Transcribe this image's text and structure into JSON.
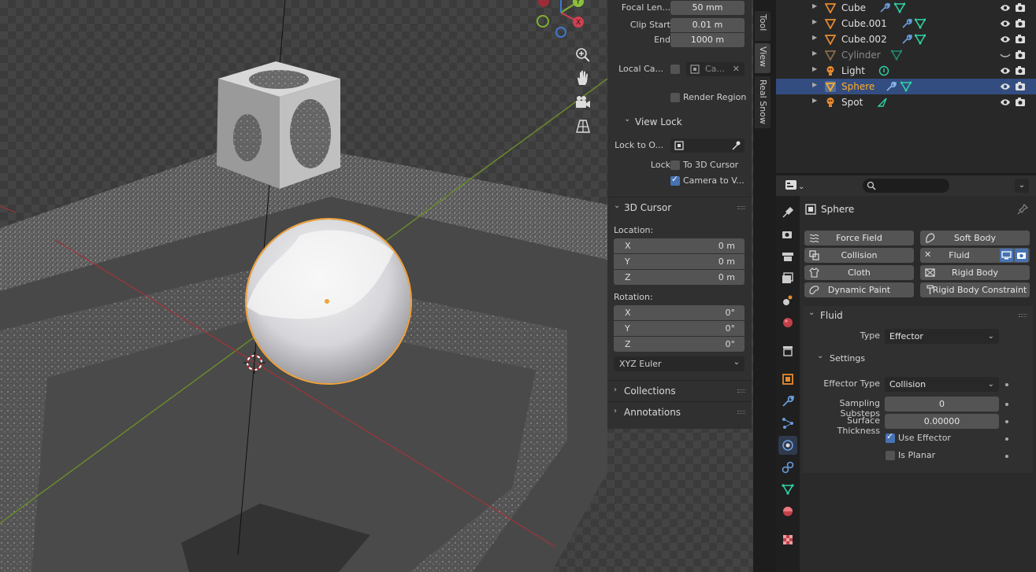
{
  "npanel": {
    "view": {
      "focal_length_label": "Focal Len...",
      "focal_length": "50 mm",
      "clip_start_label": "Clip Start",
      "clip_start": "0.01 m",
      "clip_end_label": "End",
      "clip_end": "1000 m",
      "local_camera_label": "Local Ca...",
      "local_camera_value": "Ca...",
      "render_region_label": "Render Region"
    },
    "view_lock": {
      "title": "View Lock",
      "lock_to_object_label": "Lock to O...",
      "lock_label": "Lock",
      "to_3d_cursor": "To 3D Cursor",
      "camera_to_view": "Camera to V..."
    },
    "cursor": {
      "title": "3D Cursor",
      "location_label": "Location:",
      "location": [
        {
          "axis": "X",
          "value": "0 m"
        },
        {
          "axis": "Y",
          "value": "0 m"
        },
        {
          "axis": "Z",
          "value": "0 m"
        }
      ],
      "rotation_label": "Rotation:",
      "rotation": [
        {
          "axis": "X",
          "value": "0°"
        },
        {
          "axis": "Y",
          "value": "0°"
        },
        {
          "axis": "Z",
          "value": "0°"
        }
      ],
      "rotation_mode": "XYZ Euler"
    },
    "collections_title": "Collections",
    "annotations_title": "Annotations"
  },
  "vtabs": [
    "Tool",
    "View",
    "Real Snow"
  ],
  "outliner": {
    "items": [
      {
        "name": "Cube"
      },
      {
        "name": "Cube.001"
      },
      {
        "name": "Cube.002"
      },
      {
        "name": "Cylinder"
      },
      {
        "name": "Light"
      },
      {
        "name": "Sphere"
      },
      {
        "name": "Spot"
      }
    ]
  },
  "properties": {
    "search_placeholder": "",
    "object_name": "Sphere",
    "physics_buttons": {
      "force_field": "Force Field",
      "soft_body": "Soft Body",
      "collision": "Collision",
      "fluid": "Fluid",
      "cloth": "Cloth",
      "rigid_body": "Rigid Body",
      "dynamic_paint": "Dynamic Paint",
      "rigid_body_constraint": "Rigid Body Constraint"
    },
    "fluid": {
      "title": "Fluid",
      "type_label": "Type",
      "type_value": "Effector",
      "settings_title": "Settings",
      "effector_type_label": "Effector Type",
      "effector_type_value": "Collision",
      "sampling_substeps_label": "Sampling Substeps",
      "sampling_substeps_value": "0",
      "surface_thickness_label": "Surface Thickness",
      "surface_thickness_value": "0.00000",
      "use_effector_label": "Use Effector",
      "is_planar_label": "Is Planar"
    }
  },
  "colors": {
    "accent_blue": "#4772b3",
    "selection_orange": "#ffaf29",
    "outliner_selected": "#334d80",
    "mesh_orange": "#e68a2e",
    "modifier_blue": "#6a9bdc",
    "data_green": "#2ed2a5"
  }
}
